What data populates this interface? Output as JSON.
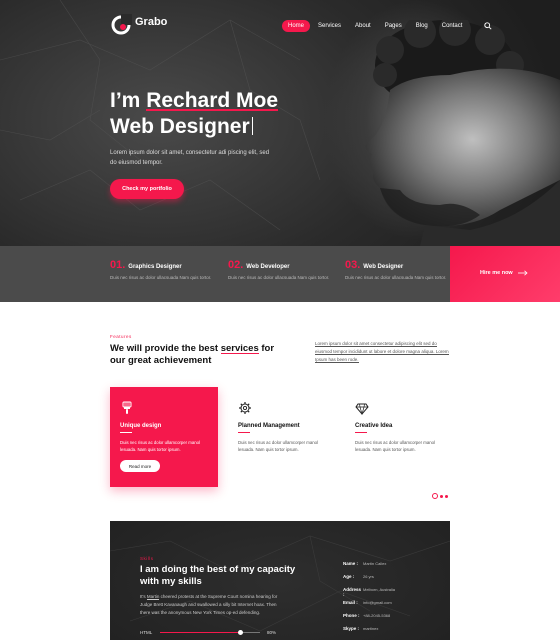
{
  "brand": {
    "name": "Grabo",
    "accent": "#f5184c"
  },
  "nav": {
    "items": [
      "Home",
      "Services",
      "About",
      "Pages",
      "Blog",
      "Contact"
    ],
    "active": "Home",
    "search_icon": "search-icon"
  },
  "hero": {
    "greeting": "I’m ",
    "name": "Rechard Moe",
    "role": "Web Designer",
    "subtitle": "Lorem ipsum dolor sit amet, consectetur adi piscing elit, sed do eiusmod tempor.",
    "cta": "Check my portfolio"
  },
  "strip": {
    "items": [
      {
        "num": "01.",
        "title": "Graphics Designer",
        "desc": "Duis nec risus ac dolor ullacsuada Nam quis tortor."
      },
      {
        "num": "02.",
        "title": "Web Developer",
        "desc": "Duis nec risus ac dolor ullacsuada Nam quis tortor."
      },
      {
        "num": "03.",
        "title": "Web Designer",
        "desc": "Duis nec risus ac dolor ullacsuada Nam quis tortor."
      }
    ],
    "hire": "Hire me now"
  },
  "features": {
    "label": "Features",
    "title_before": "We will provide the best ",
    "title_underlined": "services",
    "title_after": " for our great achievement",
    "description": "Lorem ipsum dolor sit amet consectetur adipiscing elit sed do eiusmod tempor incididunt ut labore et dolore magna aliqua. Lorem Ipsum has been rode.",
    "cards": [
      {
        "icon": "brush-icon",
        "title": "Unique design",
        "desc": "Duis nec risus ac dolor ullamcorper manol lesuada. Nam quis tortor ipsum.",
        "button": "Read more"
      },
      {
        "icon": "gear-icon",
        "title": "Planned Management",
        "desc": "Duis nec risus ac dolor ullamcorper manol lesuada. Nam quis tortor ipsum."
      },
      {
        "icon": "diamond-icon",
        "title": "Creative Idea",
        "desc": "Duis nec risus ac dolor ullamcorper manol lesuada. Nam quis tortor ipsum."
      }
    ]
  },
  "skills": {
    "label": "Skills",
    "title": "I am doing the best of my capacity with my skills",
    "desc_before": "It's ",
    "desc_link": "Martin",
    "desc_after": " cheered protests at the Supreme Court nomina hearing for Judge Brett Kavanaugh and swallowed a silly bit Internet hoax. Then there was the anonymous New York Times op-ed defending.",
    "bar": {
      "label": "HTML",
      "percent": "80%",
      "value": 0.8
    },
    "info": [
      {
        "key": "Name :",
        "value": "Martin Callex"
      },
      {
        "key": "Age :",
        "value": "26 yrs"
      },
      {
        "key": "Address :",
        "value": "Melborn, Australia"
      },
      {
        "key": "Email :",
        "value": "info@gmail.com"
      },
      {
        "key": "Phone :",
        "value": "+88-2045-5368"
      },
      {
        "key": "Skype :",
        "value": "martinex"
      }
    ]
  }
}
